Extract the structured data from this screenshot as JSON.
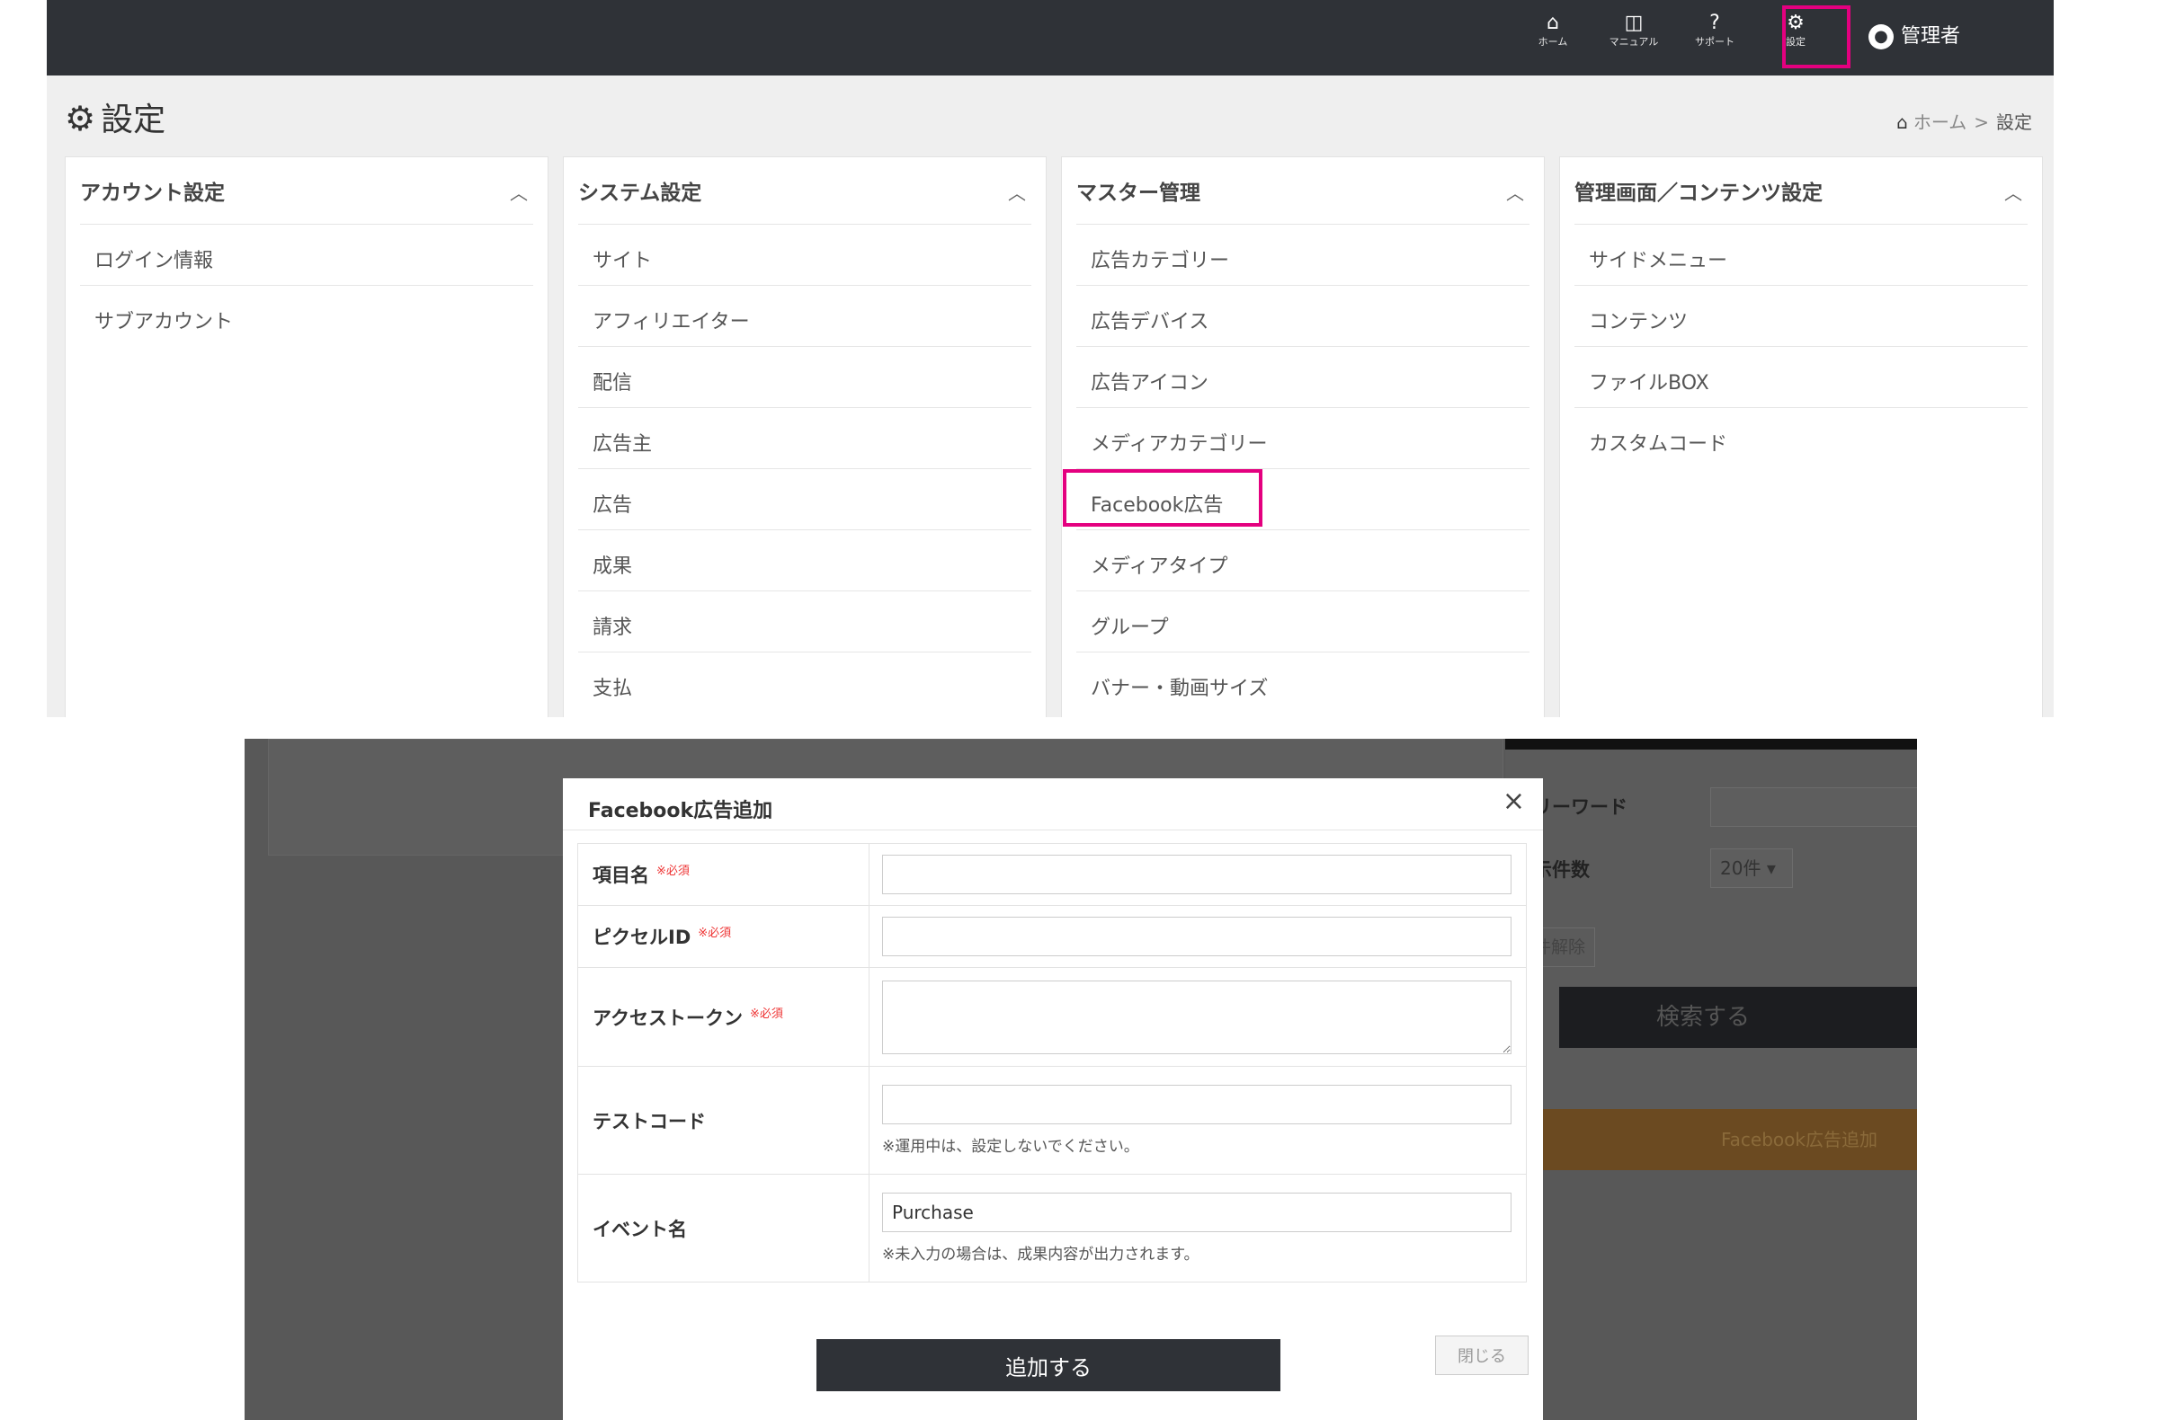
{
  "topbar": {
    "nav": [
      {
        "icon": "home-icon",
        "label": "ホーム"
      },
      {
        "icon": "book-icon",
        "label": "マニュアル"
      },
      {
        "icon": "help-icon",
        "label": "サポート"
      },
      {
        "icon": "gear-icon",
        "label": "設定"
      }
    ],
    "user_label": "管理者",
    "highlight_color": "#e4007f"
  },
  "page": {
    "title": "設定",
    "breadcrumb": {
      "home": "ホーム",
      "separator": ">",
      "current": "設定"
    }
  },
  "panels": [
    {
      "title": "アカウント設定",
      "items": [
        "ログイン情報",
        "サブアカウント"
      ]
    },
    {
      "title": "システム設定",
      "items": [
        "サイト",
        "アフィリエイター",
        "配信",
        "広告主",
        "広告",
        "成果",
        "請求",
        "支払"
      ]
    },
    {
      "title": "マスター管理",
      "items": [
        "広告カテゴリー",
        "広告デバイス",
        "広告アイコン",
        "メディアカテゴリー",
        "Facebook広告",
        "メディアタイプ",
        "グループ",
        "バナー・動画サイズ"
      ]
    },
    {
      "title": "管理画面／コンテンツ設定",
      "items": [
        "サイドメニュー",
        "コンテンツ",
        "ファイルBOX",
        "カスタムコード"
      ]
    }
  ],
  "background_search": {
    "freeword_label": "フリーワード",
    "count_label": "表示件数",
    "count_value": "20件",
    "clear_label": "条件解除",
    "search_label": "検索する",
    "add_label": "Facebook広告追加"
  },
  "modal": {
    "title": "Facebook広告追加",
    "close_symbol": "×",
    "required_mark": "※必須",
    "fields": {
      "item_name": {
        "label": "項目名",
        "value": ""
      },
      "pixel_id": {
        "label": "ピクセルID",
        "value": ""
      },
      "access_token": {
        "label": "アクセストークン",
        "value": ""
      },
      "test_code": {
        "label": "テストコード",
        "value": "",
        "help": "※運用中は、設定しないでください。"
      },
      "event_name": {
        "label": "イベント名",
        "value": "Purchase",
        "help": "※未入力の場合は、成果内容が出力されます。"
      }
    },
    "submit_label": "追加する",
    "close_label": "閉じる"
  }
}
